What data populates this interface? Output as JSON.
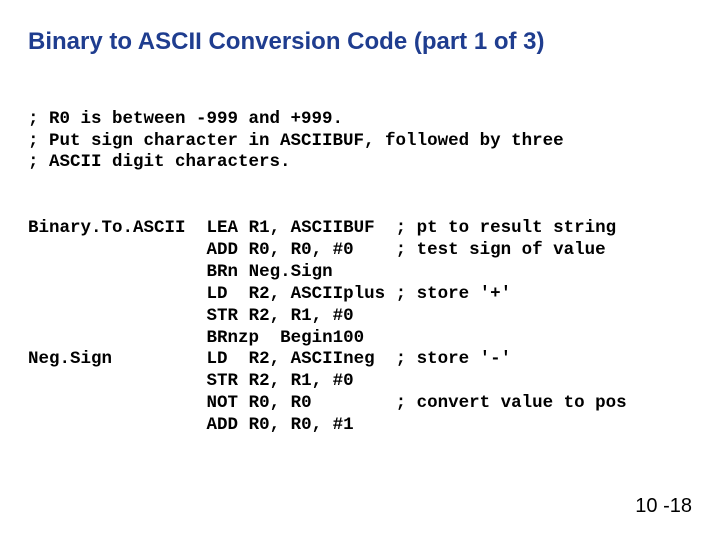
{
  "title": "Binary to ASCII Conversion Code (part 1 of 3)",
  "comments": {
    "c1": "; R0 is between -999 and +999.",
    "c2": "; Put sign character in ASCIIBUF, followed by three",
    "c3": "; ASCII digit characters."
  },
  "labels": {
    "l1": "Binary.To.ASCII",
    "l2": "Neg.Sign"
  },
  "code": {
    "r1": {
      "op": "LEA",
      "args": "R1, ASCIIBUF",
      "cmt": "; pt to result string"
    },
    "r2": {
      "op": "ADD",
      "args": "R0, R0, #0",
      "cmt": "; test sign of value"
    },
    "r3": {
      "op": "BRn",
      "args": "Neg.Sign"
    },
    "r4": {
      "op": "LD",
      "args": "R2, ASCIIplus",
      "cmt": "; store '+'"
    },
    "r5": {
      "op": "STR",
      "args": "R2, R1, #0"
    },
    "r6": {
      "op": "BRnzp",
      "args": "Begin100"
    },
    "r7": {
      "op": "LD",
      "args": "R2, ASCIIneg",
      "cmt": "; store '-'"
    },
    "r8": {
      "op": "STR",
      "args": "R2, R1, #0"
    },
    "r9": {
      "op": "NOT",
      "args": "R0, R0",
      "cmt": "; convert value to pos"
    },
    "r10": {
      "op": "ADD",
      "args": "R0, R0, #1"
    }
  },
  "page": "10 -18"
}
